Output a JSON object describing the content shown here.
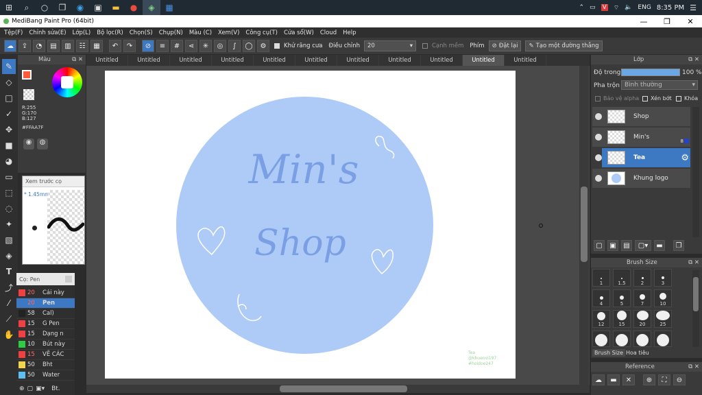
{
  "taskbar": {
    "lang": "ENG",
    "time": "8:35 PM"
  },
  "window": {
    "title": "MediBang Paint Pro (64bit)",
    "minimize": "—",
    "maximize": "❐",
    "close": "✕"
  },
  "menu": [
    "Tệp(F)",
    "Chỉnh sửa(E)",
    "Lớp(L)",
    "Bộ lọc(R)",
    "Chọn(S)",
    "Chụp(N)",
    "Màu (C)",
    "Xem(V)",
    "Công cụ(T)",
    "Cửa sổ(W)",
    "Cloud",
    "Help"
  ],
  "toolbar": {
    "antialias_label": "Khử răng cưa",
    "adjust_label": "Điều chỉnh",
    "adjust_value": "20",
    "soft_edge_label": "Cạnh mềm",
    "key_label": "Phím",
    "reset_label": "Đặt lại",
    "straight_line_label": "Tạo một đường thẳng"
  },
  "color_panel": {
    "title": "Màu",
    "r": "R:255",
    "g": "G:170",
    "b": "B:127",
    "hex": "#FFAA7F",
    "main_color": "#ff5a3c"
  },
  "preview": {
    "title": "Xem trước cọ",
    "size": "* 1.45mm"
  },
  "brush_panel": {
    "title": "Cọ: Pen",
    "footer": "Bt.",
    "items": [
      {
        "size": "20",
        "name": "Cái này",
        "color": "#f04040"
      },
      {
        "size": "20",
        "name": "Pen",
        "color": "#3d78c2"
      },
      {
        "size": "58",
        "name": "Cal)",
        "color": "#222222"
      },
      {
        "size": "15",
        "name": "G Pen",
        "color": "#f04040"
      },
      {
        "size": "15",
        "name": "Dạng n",
        "color": "#f04040"
      },
      {
        "size": "10",
        "name": "Bút này",
        "color": "#2ecc40"
      },
      {
        "size": "15",
        "name": "VẼ CÁC",
        "color": "#f04040"
      },
      {
        "size": "50",
        "name": "Bht",
        "color": "#f5d547"
      },
      {
        "size": "50",
        "name": "Water",
        "color": "#5fc0f0"
      }
    ]
  },
  "tabs": [
    "Untitled",
    "Untitled",
    "Untitled",
    "Untitled",
    "Untitled",
    "Untitled",
    "Untitled",
    "Untitled",
    "Untitled",
    "Untitled",
    "Untitled"
  ],
  "artwork": {
    "circle_color": "#aecbf7",
    "text_color": "#7b9fe4",
    "line1": "Min's",
    "line2": "Shop",
    "credit1": "Tea",
    "credit2": "@khuenvi197",
    "credit3": "#hoidoe247"
  },
  "layer_panel": {
    "title": "Lớp",
    "opacity_label": "Độ trong",
    "opacity_value": "100 %",
    "blend_label": "Pha trộn",
    "blend_value": "Bình thường",
    "protect_alpha": "Bảo vệ alpha",
    "clip": "Xén bớt",
    "lock": "Khóa",
    "layers": [
      {
        "name": "Shop"
      },
      {
        "name": "Min's"
      },
      {
        "name": "Tea"
      },
      {
        "name": "Khung logo"
      }
    ],
    "badge": "8"
  },
  "brush_size": {
    "title": "Brush Size",
    "tab1": "Brush Size",
    "tab2": "Hoa tiêu",
    "sizes": [
      "1",
      "1.5",
      "2",
      "3",
      "4",
      "5",
      "7",
      "10",
      "12",
      "15",
      "20",
      "25"
    ]
  },
  "reference": {
    "title": "Reference"
  }
}
